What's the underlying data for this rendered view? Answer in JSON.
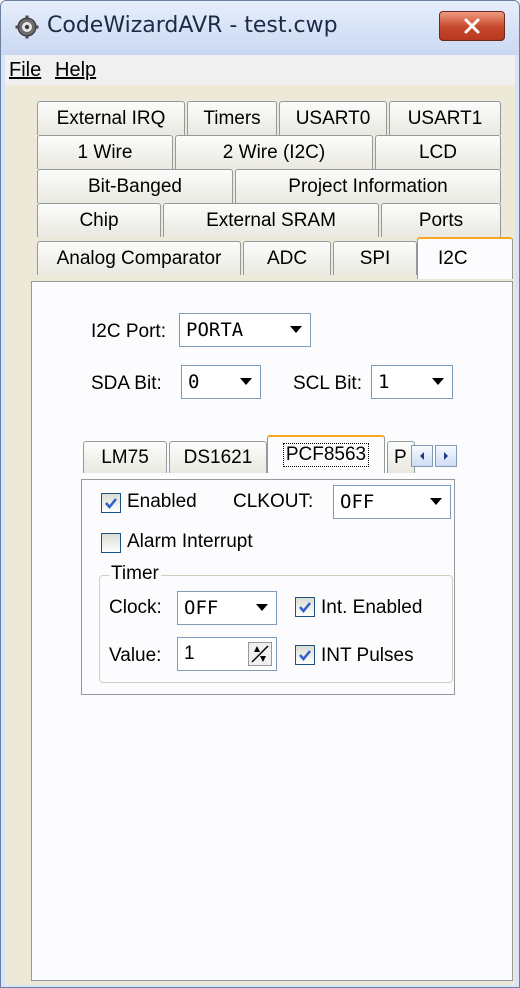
{
  "window": {
    "title": "CodeWizardAVR - test.cwp"
  },
  "menu": {
    "file": "File",
    "help": "Help"
  },
  "tabs": {
    "row1": [
      "External IRQ",
      "Timers",
      "USART0",
      "USART1"
    ],
    "row2": [
      "1 Wire",
      "2 Wire (I2C)",
      "LCD"
    ],
    "row3": [
      "Bit-Banged",
      "Project Information"
    ],
    "row4": [
      "Chip",
      "External SRAM",
      "Ports"
    ],
    "row5": [
      "Analog Comparator",
      "ADC",
      "SPI",
      "I2C"
    ]
  },
  "i2c": {
    "port_label": "I2C Port:",
    "port_value": "PORTA",
    "sda_label": "SDA Bit:",
    "sda_value": "0",
    "scl_label": "SCL Bit:",
    "scl_value": "1"
  },
  "subtabs": [
    "LM75",
    "DS1621",
    "PCF8563",
    "P"
  ],
  "pcf8563": {
    "enabled_label": "Enabled",
    "enabled_checked": true,
    "clkout_label": "CLKOUT:",
    "clkout_value": "OFF",
    "alarm_label": "Alarm Interrupt",
    "alarm_checked": false,
    "timer_group": "Timer",
    "clock_label": "Clock:",
    "clock_value": "OFF",
    "int_enabled_label": "Int. Enabled",
    "int_enabled_checked": true,
    "value_label": "Value:",
    "value_value": "1",
    "int_pulses_label": "INT Pulses",
    "int_pulses_checked": true
  },
  "colors": {
    "accent": "#f5a623",
    "check": "#2d62c8"
  }
}
